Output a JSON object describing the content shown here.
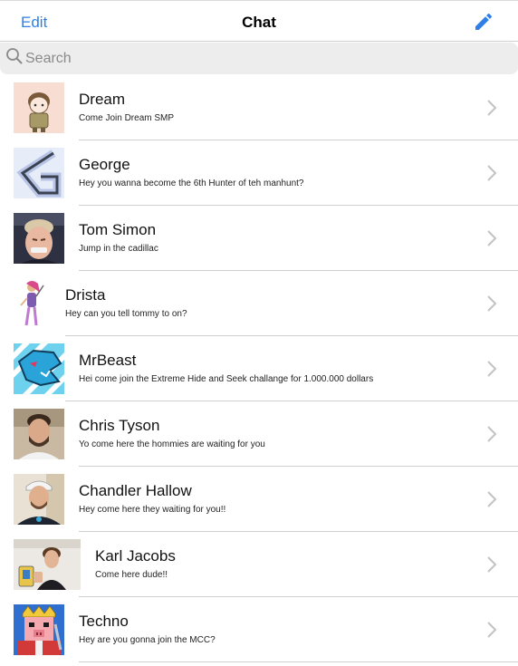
{
  "header": {
    "edit_label": "Edit",
    "title": "Chat",
    "compose_icon": "pencil-icon"
  },
  "search": {
    "placeholder": "Search",
    "icon": "search-icon"
  },
  "colors": {
    "accent": "#2e80e8",
    "separator": "#cfcfcf",
    "search_bg": "#ededed"
  },
  "chats": [
    {
      "name": "Dream",
      "message": "Come Join Dream SMP",
      "avatar": "cartoon-character-avatar"
    },
    {
      "name": "George",
      "message": "Hey you wanna become the 6th Hunter of teh manhunt?",
      "avatar": "letter-g-logo-avatar"
    },
    {
      "name": "Tom Simon",
      "message": "Jump in the cadillac",
      "avatar": "person-photo-avatar"
    },
    {
      "name": "Drista",
      "message": "Hey can you tell tommy to on?",
      "avatar": "drawn-figure-avatar"
    },
    {
      "name": "MrBeast",
      "message": "Hei come join the Extreme Hide and Seek challange for 1.000.000 dollars",
      "avatar": "beast-logo-avatar"
    },
    {
      "name": "Chris Tyson",
      "message": "Yo come here the hommies are waiting for you",
      "avatar": "person-photo-avatar"
    },
    {
      "name": "Chandler Hallow",
      "message": "Hey come here they waiting for you!!",
      "avatar": "person-photo-avatar"
    },
    {
      "name": "Karl Jacobs",
      "message": "Come here dude!!",
      "avatar": "person-photo-avatar"
    },
    {
      "name": "Techno",
      "message": "Hey are you gonna join the MCC?",
      "avatar": "pig-king-avatar"
    }
  ]
}
